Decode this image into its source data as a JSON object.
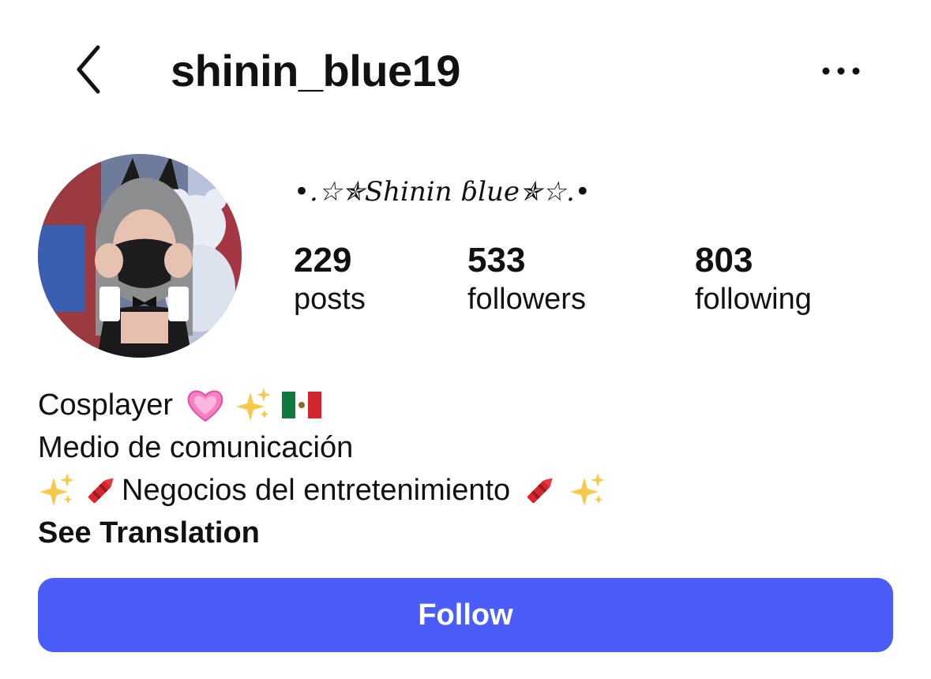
{
  "header": {
    "username": "shinin_blue19",
    "back_icon": "chevron-left-icon",
    "more_icon": "more-horizontal-icon"
  },
  "profile": {
    "display_name": "•.☆✯Shinin ɓlue✯☆.•",
    "avatar_alt": "profile photo"
  },
  "stats": {
    "posts": {
      "count": "229",
      "label": "posts"
    },
    "followers": {
      "count": "533",
      "label": "followers"
    },
    "following": {
      "count": "803",
      "label": "following"
    }
  },
  "bio": {
    "line1_text": "Cosplayer",
    "line1_icons": [
      "heart-icon",
      "sparkles-icon",
      "mexico-flag-icon"
    ],
    "line2_text": "Medio de comunicación",
    "line3_text": "Negocios del entretenimiento",
    "line3_icons_left": [
      "sparkles-icon",
      "crayon-icon"
    ],
    "line3_icons_right": [
      "crayon-icon",
      "sparkles-icon"
    ],
    "see_translation": "See Translation"
  },
  "actions": {
    "follow_label": "Follow"
  },
  "colors": {
    "follow_button": "#4a5df9",
    "text": "#111111",
    "background": "#ffffff"
  }
}
